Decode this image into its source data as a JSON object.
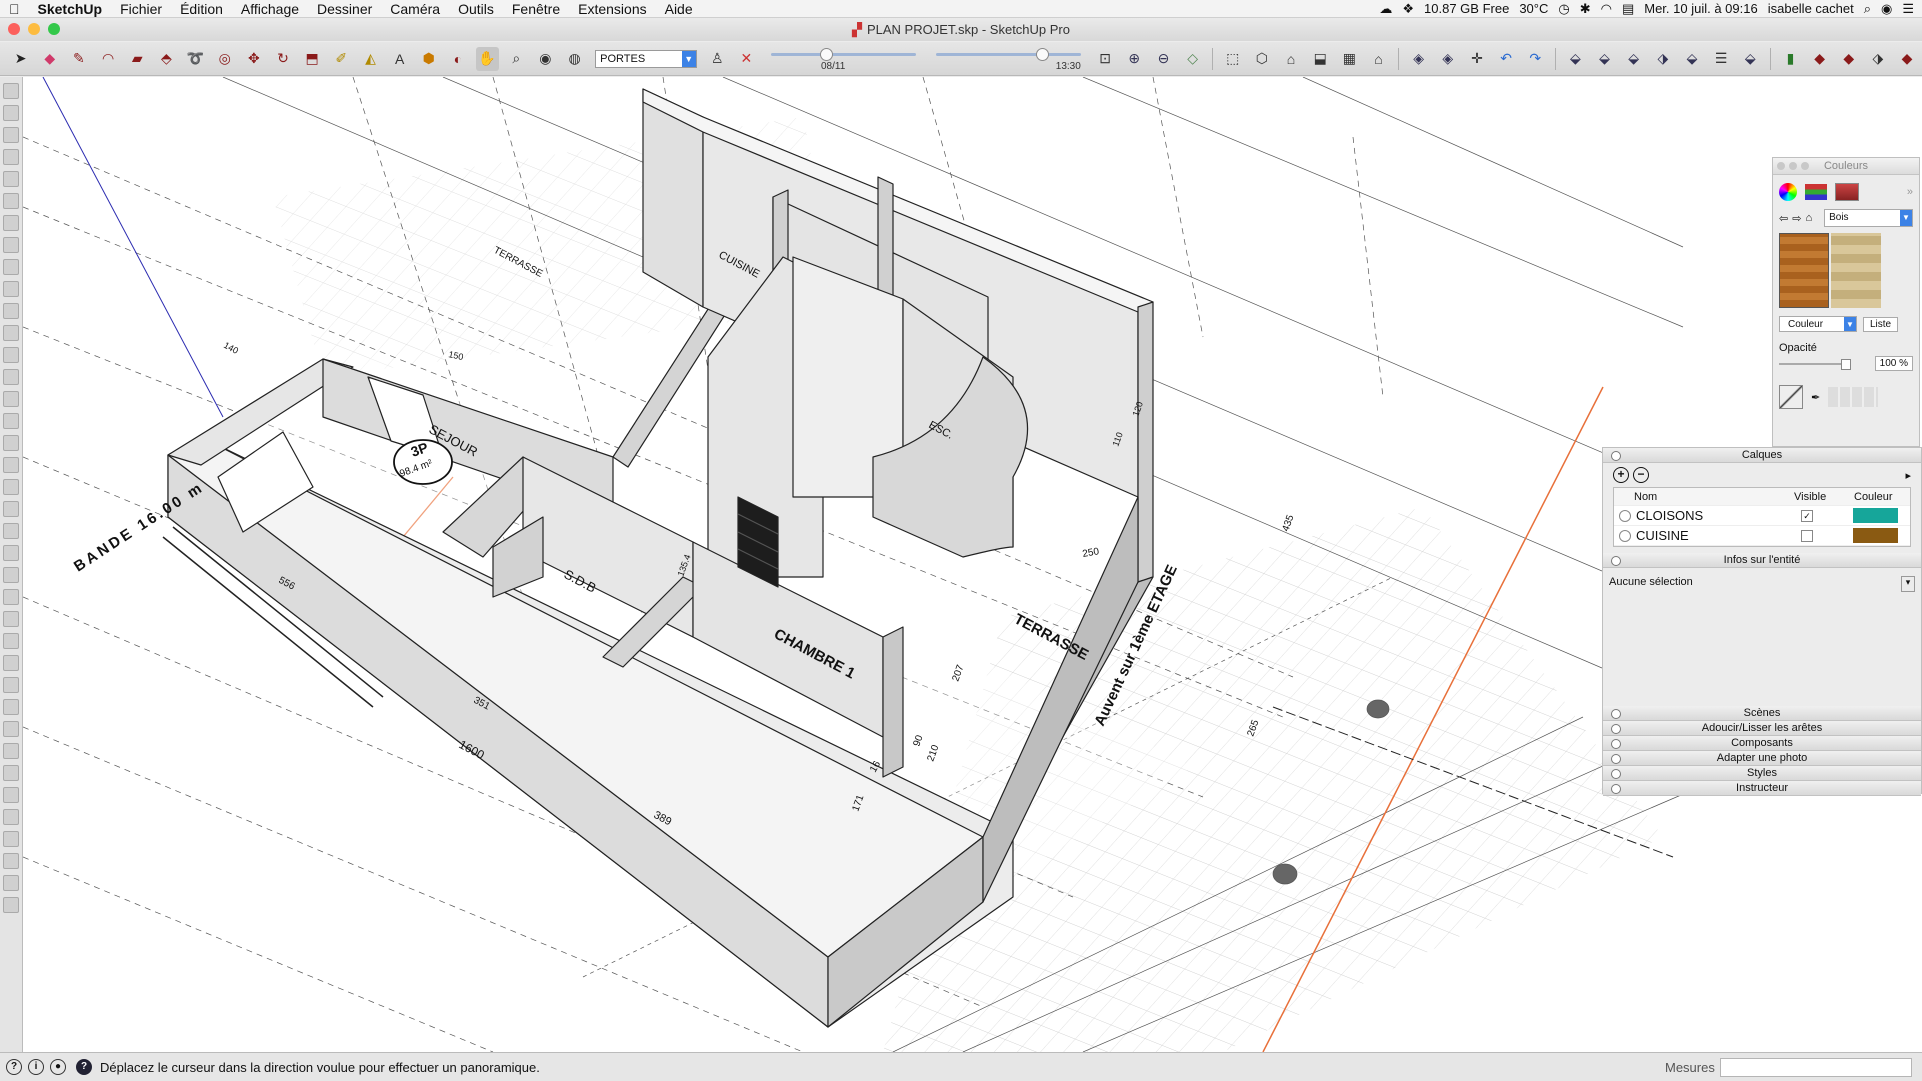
{
  "menubar": {
    "app": "SketchUp",
    "items": [
      "Fichier",
      "Édition",
      "Affichage",
      "Dessiner",
      "Caméra",
      "Outils",
      "Fenêtre",
      "Extensions",
      "Aide"
    ],
    "status": {
      "storage": "10.87 GB Free",
      "temp": "30°C",
      "datetime": "Mer. 10 juil. à  09:16",
      "user": "isabelle cachet"
    }
  },
  "window": {
    "title": "PLAN PROJET.skp - SketchUp Pro"
  },
  "toolbar": {
    "scene_select": "PORTES",
    "shadow_date": "08/11",
    "shadow_time": "13:30",
    "shadow_date_level": 0.35,
    "shadow_time_level": 0.72
  },
  "viewport": {
    "labels": {
      "sejour": "SEJOUR",
      "cuisine": "CUISINE",
      "sdb": "S.D.B",
      "chambre": "CHAMBRE 1",
      "esc": "ESC.",
      "terrasse_top": "TERRASSE",
      "terrasse_right": "TERRASSE",
      "bande": "BANDE  16.00 m",
      "auvent": "Auvent sur 1ème ETAGE",
      "badge_top": "3P",
      "badge_bottom": "98.4 m²"
    },
    "dimensions": [
      "556",
      "351",
      "1600",
      "389",
      "250",
      "207",
      "171",
      "16",
      "90",
      "210",
      "135.4",
      "120",
      "110",
      "265",
      "435",
      "140",
      "150"
    ]
  },
  "colors_panel": {
    "title": "Couleurs",
    "library": "Bois",
    "mode": "Couleur",
    "list_button": "Liste",
    "opacity_label": "Opacité",
    "opacity_value": "100 %",
    "opacity_level": 1.0
  },
  "layers_panel": {
    "title": "Calques",
    "columns": {
      "name": "Nom",
      "visible": "Visible",
      "color": "Couleur"
    },
    "rows": [
      {
        "name": "CLOISONS",
        "visible": "✓",
        "color": "#16a69a"
      },
      {
        "name": "CUISINE",
        "visible": "",
        "color": "#8a5a12"
      }
    ]
  },
  "entity_panel": {
    "title": "Infos sur l'entité",
    "selection": "Aucune sélection"
  },
  "trays": [
    "Scènes",
    "Adoucir/Lisser les arêtes",
    "Composants",
    "Adapter une photo",
    "Styles",
    "Instructeur"
  ],
  "statusbar": {
    "message": "Déplacez le curseur dans la direction voulue pour effectuer un panoramique.",
    "measure_label": "Mesures"
  }
}
